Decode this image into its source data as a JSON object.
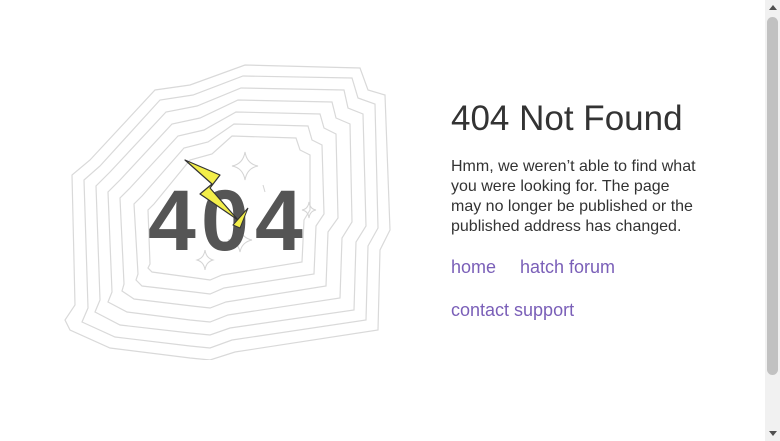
{
  "illustration": {
    "graphic_text": "404",
    "icons": [
      "lightning-bolt-icon",
      "sparkle-icon"
    ],
    "colors": {
      "digits": "#555555",
      "bolt": "#f3ee4a",
      "lines": "#d6d6d6"
    }
  },
  "error": {
    "title": "404 Not Found",
    "message": "Hmm, we weren’t able to find what you were looking for. The page may no longer be published or the published address has changed."
  },
  "links": {
    "home": "home",
    "forum": "hatch forum",
    "support": "contact support"
  },
  "colors": {
    "link": "#7a5fb8",
    "text": "#333333"
  }
}
